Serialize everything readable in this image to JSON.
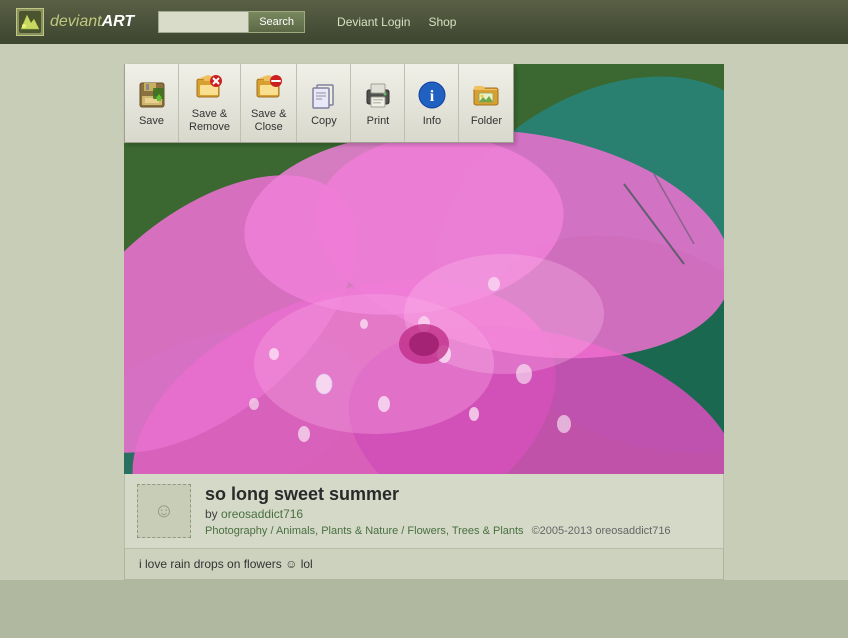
{
  "header": {
    "logo_text_plain": "deviant",
    "logo_text_bold": "ART",
    "search_placeholder": "",
    "search_button_label": "Search",
    "nav": {
      "login_label": "Deviant Login",
      "shop_label": "Shop"
    }
  },
  "toolbar": {
    "items": [
      {
        "id": "save",
        "label": "Save",
        "icon": "💾"
      },
      {
        "id": "save-remove",
        "label": "Save &\nRemove",
        "icon": "📁"
      },
      {
        "id": "save-close",
        "label": "Save &\nClose",
        "icon": "📂"
      },
      {
        "id": "copy",
        "label": "Copy",
        "icon": "📋"
      },
      {
        "id": "print",
        "label": "Print",
        "icon": "🖨"
      },
      {
        "id": "info",
        "label": "Info",
        "icon": "ℹ"
      },
      {
        "id": "folder",
        "label": "Folder",
        "icon": "🖼"
      }
    ]
  },
  "artwork": {
    "title": "so long sweet summer",
    "author": "oreosaddict716",
    "by_label": "by",
    "categories": {
      "cat1": "Photography",
      "sep1": " / ",
      "cat2": "Animals, Plants & Nature",
      "sep2": " / ",
      "cat3": "Flowers, Trees & Plants"
    },
    "copyright": "©2005-2013 oreosaddict716"
  },
  "comment": {
    "text": "i love rain drops on flowers",
    "emoji": "☺",
    "suffix": " lol"
  }
}
